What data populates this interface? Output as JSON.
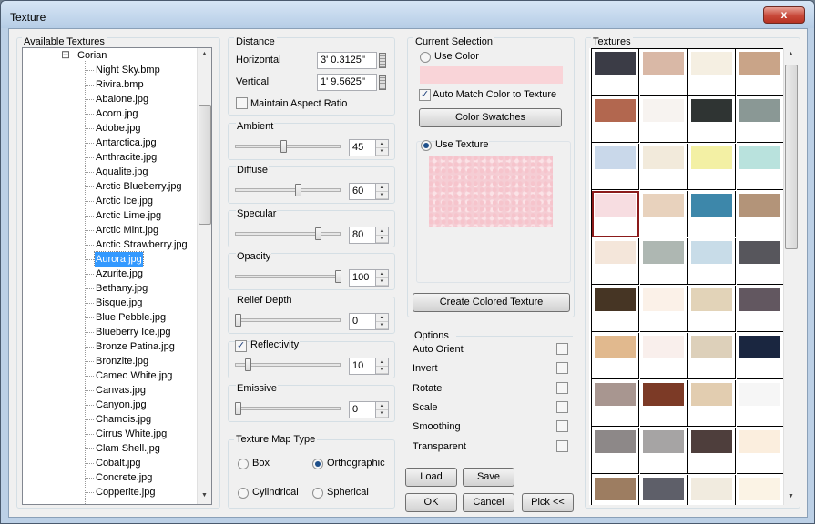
{
  "window": {
    "title": "Texture",
    "close_glyph": "x"
  },
  "tree": {
    "group_label": "Available Textures",
    "root": "Corian",
    "expander": "⊟",
    "selected_index": 13,
    "items": [
      "Night Sky.bmp",
      "Rivira.bmp",
      "Abalone.jpg",
      "Acorn.jpg",
      "Adobe.jpg",
      "Antarctica.jpg",
      "Anthracite.jpg",
      "Aqualite.jpg",
      "Arctic Blueberry.jpg",
      "Arctic Ice.jpg",
      "Arctic Lime.jpg",
      "Arctic Mint.jpg",
      "Arctic Strawberry.jpg",
      "Aurora.jpg",
      "Azurite.jpg",
      "Bethany.jpg",
      "Bisque.jpg",
      "Blue Pebble.jpg",
      "Blueberry Ice.jpg",
      "Bronze Patina.jpg",
      "Bronzite.jpg",
      "Cameo White.jpg",
      "Canvas.jpg",
      "Canyon.jpg",
      "Chamois.jpg",
      "Cirrus White.jpg",
      "Clam Shell.jpg",
      "Cobalt.jpg",
      "Concrete.jpg",
      "Copperite.jpg"
    ]
  },
  "distance": {
    "label": "Distance",
    "horizontal_label": "Horizontal",
    "horizontal_value": "3' 0.3125''",
    "vertical_label": "Vertical",
    "vertical_value": "1' 9.5625''",
    "aspect_label": "Maintain Aspect Ratio",
    "aspect_checked": false
  },
  "sliders": [
    {
      "label": "Ambient",
      "value": "45",
      "level": 0.45
    },
    {
      "label": "Diffuse",
      "value": "60",
      "level": 0.6
    },
    {
      "label": "Specular",
      "value": "80",
      "level": 0.8
    },
    {
      "label": "Opacity",
      "value": "100",
      "level": 1.0
    },
    {
      "label": "Relief Depth",
      "value": "0",
      "level": 0.0
    },
    {
      "label": "Reflectivity",
      "value": "10",
      "level": 0.1
    },
    {
      "label": "Emissive",
      "value": "0",
      "level": 0.0
    }
  ],
  "reflectivity_checked": true,
  "mapping": {
    "label": "Texture Map Type",
    "box": "Box",
    "orthographic": "Orthographic",
    "cylindrical": "Cylindrical",
    "spherical": "Spherical",
    "selected": "Orthographic"
  },
  "current": {
    "label": "Current Selection",
    "use_color": "Use Color",
    "auto_match": "Auto Match Color to Texture",
    "auto_match_checked": true,
    "swatches_btn": "Color Swatches",
    "use_texture": "Use Texture",
    "selected": "Use Texture",
    "color_preview": "#fadadd",
    "create_btn": "Create Colored Texture"
  },
  "options": {
    "label": "Options",
    "items": [
      "Auto Orient",
      "Invert",
      "Rotate",
      "Scale",
      "Smoothing",
      "Transparent"
    ]
  },
  "buttons": {
    "load": "Load",
    "save": "Save",
    "ok": "OK",
    "cancel": "Cancel",
    "pick": "Pick <<"
  },
  "textures": {
    "label": "Textures",
    "selected_index": 12,
    "colors": [
      "#3b3c46",
      "#d9b8a6",
      "#f5efe2",
      "#c9a488",
      "#b2674f",
      "#f7f3f0",
      "#2f3433",
      "#8a9895",
      "#c9d8ea",
      "#f2eadb",
      "#f3f0a4",
      "#b9e2dd",
      "#f7dde1",
      "#e8d2bd",
      "#3d87aa",
      "#b39479",
      "#f4e6da",
      "#aeb7b2",
      "#c8dce8",
      "#57565c",
      "#463524",
      "#fbf1e8",
      "#e2d3b8",
      "#625760",
      "#e1b98e",
      "#f9efec",
      "#ddd0ba",
      "#1a2640",
      "#a89690",
      "#7c3a26",
      "#e2cdb0",
      "#f6f6f6",
      "#8d8888",
      "#a6a4a4",
      "#4e3e3c",
      "#fbeede",
      "#9d7d61",
      "#5e5f69",
      "#f1ebdf",
      "#fbf3e5"
    ]
  }
}
